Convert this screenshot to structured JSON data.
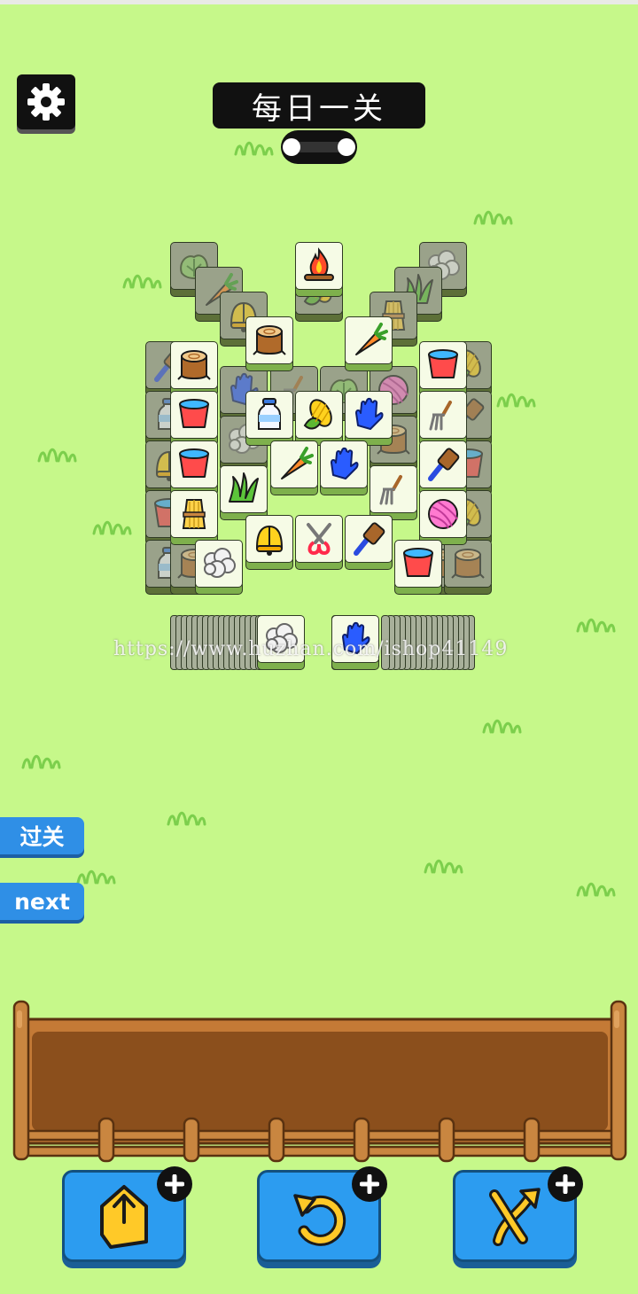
{
  "header": {
    "title": "每日一关",
    "progress_fraction": 0
  },
  "board": {
    "tiles": [
      {
        "icon": "lettuce",
        "dim": true
      },
      {
        "icon": "carrot",
        "dim": true
      },
      {
        "icon": "bell",
        "dim": true
      },
      {
        "icon": "campfire",
        "dim": false
      },
      {
        "icon": "corn",
        "dim": true
      },
      {
        "icon": "wool",
        "dim": true
      },
      {
        "icon": "grass",
        "dim": true
      },
      {
        "icon": "wheat",
        "dim": true
      },
      {
        "icon": "stump",
        "dim": false
      },
      {
        "icon": "carrot",
        "dim": false
      },
      {
        "icon": "brush",
        "dim": true
      },
      {
        "icon": "stump",
        "dim": false
      },
      {
        "icon": "glove",
        "dim": true
      },
      {
        "icon": "pitchfork",
        "dim": true
      },
      {
        "icon": "lettuce",
        "dim": true
      },
      {
        "icon": "yarn-ball",
        "dim": true
      },
      {
        "icon": "bucket",
        "dim": false
      },
      {
        "icon": "corn",
        "dim": true
      },
      {
        "icon": "milk-bottle",
        "dim": true
      },
      {
        "icon": "bucket",
        "dim": false
      },
      {
        "icon": "milk-bottle",
        "dim": false
      },
      {
        "icon": "corn",
        "dim": false
      },
      {
        "icon": "glove",
        "dim": false
      },
      {
        "icon": "pitchfork",
        "dim": false
      },
      {
        "icon": "brush",
        "dim": true
      },
      {
        "icon": "bell",
        "dim": true
      },
      {
        "icon": "bucket",
        "dim": false
      },
      {
        "icon": "wool",
        "dim": true
      },
      {
        "icon": "carrot",
        "dim": false
      },
      {
        "icon": "glove",
        "dim": false
      },
      {
        "icon": "stump",
        "dim": true
      },
      {
        "icon": "brush",
        "dim": false
      },
      {
        "icon": "bucket",
        "dim": true
      },
      {
        "icon": "bucket",
        "dim": true
      },
      {
        "icon": "wheat",
        "dim": false
      },
      {
        "icon": "grass",
        "dim": false
      },
      {
        "icon": "pitchfork",
        "dim": false
      },
      {
        "icon": "yarn-ball",
        "dim": false
      },
      {
        "icon": "corn",
        "dim": true
      },
      {
        "icon": "milk-bottle",
        "dim": true
      },
      {
        "icon": "stump",
        "dim": true
      },
      {
        "icon": "wool",
        "dim": false
      },
      {
        "icon": "bell",
        "dim": false
      },
      {
        "icon": "shears",
        "dim": false
      },
      {
        "icon": "brush",
        "dim": false
      },
      {
        "icon": "bucket",
        "dim": false
      },
      {
        "icon": "stump",
        "dim": true
      },
      {
        "icon": "stump",
        "dim": true
      }
    ],
    "left_stack_top": "wool",
    "right_stack_top": "glove"
  },
  "watermark": "https://www.huzhan.com/ishop41149",
  "side_buttons": {
    "pass_label": "过关",
    "next_label": "next"
  },
  "tools": [
    {
      "icon": "move-out-icon"
    },
    {
      "icon": "undo-icon"
    },
    {
      "icon": "shuffle-icon"
    }
  ],
  "colors": {
    "background": "#c6f88a",
    "tile_face": "#f6fbe6",
    "tile_edge": "#7eb04c",
    "tool_button": "#2c9cf0",
    "tray": "#8b4f1c"
  }
}
